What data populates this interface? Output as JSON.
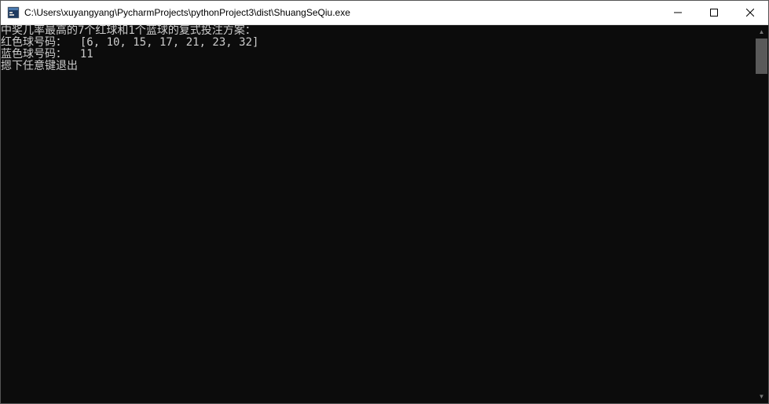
{
  "window": {
    "title": "C:\\Users\\xuyangyang\\PycharmProjects\\pythonProject3\\dist\\ShuangSeQiu.exe"
  },
  "console": {
    "lines": [
      "中奖几率最高的7个红球和1个蓝球的复式投注方案：",
      "红色球号码：  [6, 10, 15, 17, 21, 23, 32]",
      "蓝色球号码：  11",
      "摁下任意键退出"
    ]
  }
}
